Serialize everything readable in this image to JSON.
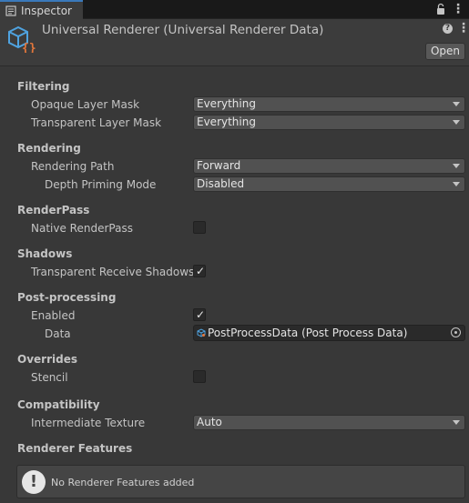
{
  "tab": {
    "title": "Inspector"
  },
  "header": {
    "title": "Universal Renderer (Universal Renderer Data)",
    "help_glyph": "?",
    "open_label": "Open"
  },
  "sections": {
    "filtering": {
      "title": "Filtering",
      "opaque_label": "Opaque Layer Mask",
      "opaque_value": "Everything",
      "transparent_label": "Transparent Layer Mask",
      "transparent_value": "Everything"
    },
    "rendering": {
      "title": "Rendering",
      "path_label": "Rendering Path",
      "path_value": "Forward",
      "depth_label": "Depth Priming Mode",
      "depth_value": "Disabled"
    },
    "renderpass": {
      "title": "RenderPass",
      "native_label": "Native RenderPass",
      "native_checked": false
    },
    "shadows": {
      "title": "Shadows",
      "receive_label": "Transparent Receive Shadows",
      "receive_checked": true
    },
    "postprocessing": {
      "title": "Post-processing",
      "enabled_label": "Enabled",
      "enabled_checked": true,
      "data_label": "Data",
      "data_value": "PostProcessData (Post Process Data)"
    },
    "overrides": {
      "title": "Overrides",
      "stencil_label": "Stencil",
      "stencil_checked": false
    },
    "compatibility": {
      "title": "Compatibility",
      "intermediate_label": "Intermediate Texture",
      "intermediate_value": "Auto"
    },
    "features": {
      "title": "Renderer Features",
      "empty_message": "No Renderer Features added",
      "warn_glyph": "!"
    }
  },
  "check_glyph": "✓",
  "colors": {
    "tab_accent": "#3a79bb",
    "asset_icon_blue": "#4fa3e0",
    "asset_icon_orange": "#e2763b"
  }
}
